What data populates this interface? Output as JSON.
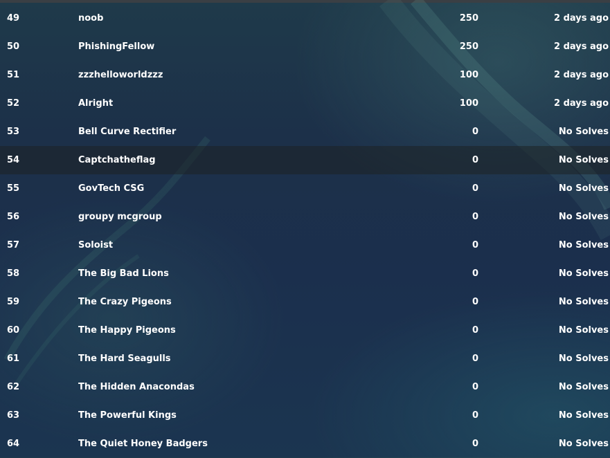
{
  "scoreboard": {
    "rows": [
      {
        "place": "49",
        "team": "noob",
        "score": "250",
        "time": "2 days ago"
      },
      {
        "place": "50",
        "team": "PhishingFellow",
        "score": "250",
        "time": "2 days ago"
      },
      {
        "place": "51",
        "team": "zzzhelloworldzzz",
        "score": "100",
        "time": "2 days ago"
      },
      {
        "place": "52",
        "team": "Alright",
        "score": "100",
        "time": "2 days ago"
      },
      {
        "place": "53",
        "team": "Bell Curve Rectifier",
        "score": "0",
        "time": "No Solves"
      },
      {
        "place": "54",
        "team": "Captchatheflag",
        "score": "0",
        "time": "No Solves"
      },
      {
        "place": "55",
        "team": "GovTech CSG",
        "score": "0",
        "time": "No Solves"
      },
      {
        "place": "56",
        "team": "groupy mcgroup",
        "score": "0",
        "time": "No Solves"
      },
      {
        "place": "57",
        "team": "Soloist",
        "score": "0",
        "time": "No Solves"
      },
      {
        "place": "58",
        "team": "The Big Bad Lions",
        "score": "0",
        "time": "No Solves"
      },
      {
        "place": "59",
        "team": "The Crazy Pigeons",
        "score": "0",
        "time": "No Solves"
      },
      {
        "place": "60",
        "team": "The Happy Pigeons",
        "score": "0",
        "time": "No Solves"
      },
      {
        "place": "61",
        "team": "The Hard Seagulls",
        "score": "0",
        "time": "No Solves"
      },
      {
        "place": "62",
        "team": "The Hidden Anacondas",
        "score": "0",
        "time": "No Solves"
      },
      {
        "place": "63",
        "team": "The Powerful Kings",
        "score": "0",
        "time": "No Solves"
      },
      {
        "place": "64",
        "team": "The Quiet Honey Badgers",
        "score": "0",
        "time": "No Solves"
      }
    ]
  },
  "colors": {
    "text": "#ffffff",
    "highlight_row": "#1e2224",
    "background": "#1b2f4d"
  }
}
